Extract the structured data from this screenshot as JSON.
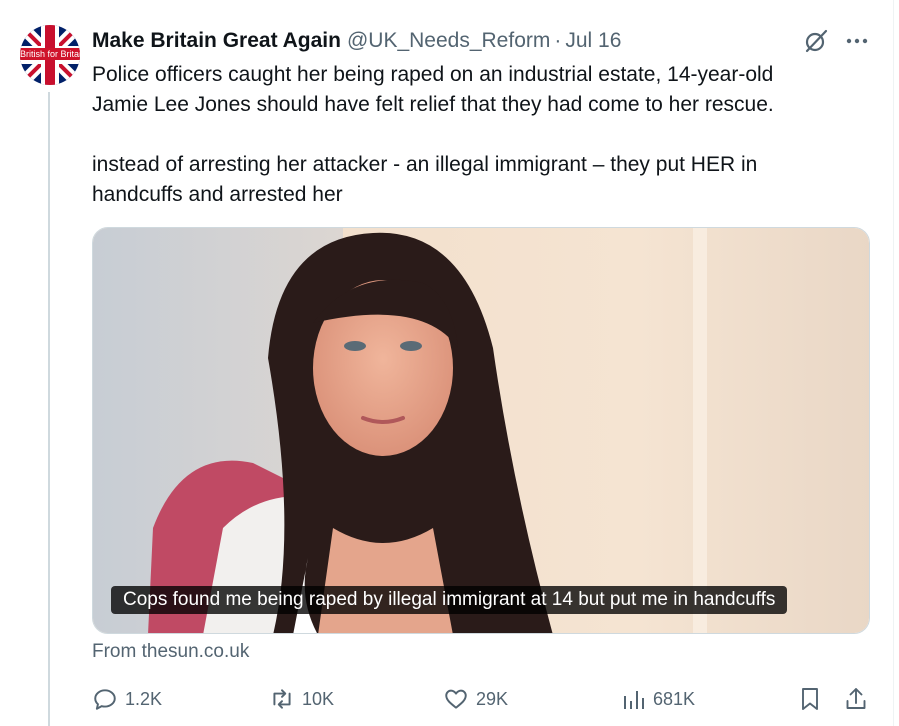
{
  "tweet": {
    "author": {
      "display_name": "Make Britain Great Again",
      "handle": "@UK_Needs_Reform",
      "avatar_text": "British for Britain"
    },
    "separator": "·",
    "date": "Jul 16",
    "text_paragraphs": [
      "Police officers caught her being raped on an industrial estate, 14-year-old\nJamie Lee Jones should have felt relief that they had come to her rescue.",
      "instead of arresting her attacker - an illegal immigrant – they put HER in\nhandcuffs and arrested her"
    ],
    "media": {
      "caption": "Cops found me being raped by illegal immigrant at 14 but put me in handcuffs"
    },
    "source": "From thesun.co.uk",
    "actions": {
      "replies": "1.2K",
      "reposts": "10K",
      "likes": "29K",
      "views": "681K"
    }
  },
  "icons": {
    "grok": "grok-icon",
    "more": "more-icon",
    "reply": "reply-icon",
    "repost": "repost-icon",
    "like": "heart-icon",
    "views": "views-icon",
    "bookmark": "bookmark-icon",
    "share": "share-icon"
  },
  "colors": {
    "text_primary": "#0f1419",
    "text_secondary": "#536471",
    "thread_line": "#cfd9de",
    "flag_blue": "#012169",
    "flag_red": "#c8102e"
  }
}
